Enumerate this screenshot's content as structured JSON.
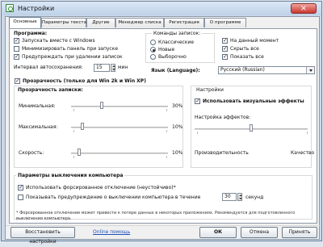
{
  "window": {
    "title": "Настройки",
    "close_symbol": "×"
  },
  "tabs": [
    "Основные",
    "Параметры текста",
    "Другие",
    "Менеджер списка",
    "Регистрация",
    "О программе"
  ],
  "program": {
    "title": "Программа:",
    "items": [
      {
        "label": "Запускать вместе с Windows",
        "checked": true
      },
      {
        "label": "Минимизировать панель при запуске",
        "checked": false
      },
      {
        "label": "Предупреждать при удалении записок",
        "checked": true
      }
    ],
    "interval_label": "Интервал автосохранения:",
    "interval_value": "15",
    "interval_unit": "мин"
  },
  "commands": {
    "title": "Команды записок:",
    "radios": [
      {
        "label": "Классические",
        "checked": false
      },
      {
        "label": "Новые",
        "checked": true
      },
      {
        "label": "Выборочно",
        "checked": false
      }
    ],
    "checks": [
      {
        "label": "На данный момент",
        "checked": true
      },
      {
        "label": "Скрыть все",
        "checked": true
      },
      {
        "label": "Показать все",
        "checked": true
      }
    ]
  },
  "language": {
    "label": "Язык (Language):",
    "value": "Русский (Russian)"
  },
  "transparency": {
    "title": "Прозрачность (только для Win 2k и Win XP)",
    "section": "Прозрачность записки:",
    "rows": [
      {
        "label": "Минимальная:",
        "value": "30%",
        "level": 0.3
      },
      {
        "label": "Максимальная:",
        "value": "10%",
        "level": 0.1
      },
      {
        "label": "Скорость:",
        "value": "10%",
        "level": 0.1
      }
    ]
  },
  "settings": {
    "title": "Настройки",
    "visual_effects": "Использовать визуальные эффекты",
    "effects_label": "Настройка эффектов:",
    "left_text": "Производительность",
    "right_text": "Качество",
    "level": 0.5
  },
  "shutdown": {
    "title": "Параметры выключения компьютера",
    "forced": "Использовать форсированное отключение (неустойчиво)*",
    "warning": "Показывать предупреждение о выключении компьютера в течение",
    "seconds_value": "30",
    "seconds_unit": "секунд",
    "note": "* Форсированное отключение может привести к потере данных в некоторых приложениях. Рекомендуется для подготовленного выключения компьютера."
  },
  "footer": {
    "restore": "Восстановить настройки",
    "help": "Online помощь",
    "ok": "ОК",
    "cancel": "Отмена",
    "apply": "Принять"
  }
}
